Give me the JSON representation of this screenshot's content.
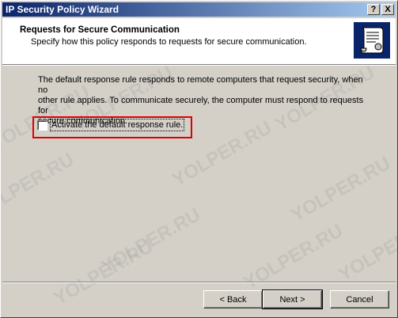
{
  "window": {
    "title": "IP Security Policy Wizard",
    "help_glyph": "?",
    "close_glyph": "X"
  },
  "header": {
    "title": "Requests for Secure Communication",
    "subtitle": "Specify how this policy responds to requests for secure communication.",
    "icon": "scroll-certificate-icon"
  },
  "body": {
    "description_lines": [
      "The default response rule responds to remote computers that request security, when no",
      "other rule applies. To communicate securely, the computer must respond to requests for",
      "secure communication."
    ],
    "checkbox": {
      "label": "Activate the default response rule.",
      "checked": false
    },
    "highlight_color": "#e00000"
  },
  "watermarks": [
    "YOLPER.RU",
    "YOLPER.RU",
    "YOLPER.RU",
    "YOLPER.RU",
    "YOLPER.RU",
    "YOLPER.RU",
    "YOLPER.RU",
    "YOLPER.RU",
    "YOLPER.RU",
    "YOLPER.RU"
  ],
  "buttons": {
    "back_label": "< Back",
    "next_label": "Next >",
    "cancel_label": "Cancel"
  }
}
